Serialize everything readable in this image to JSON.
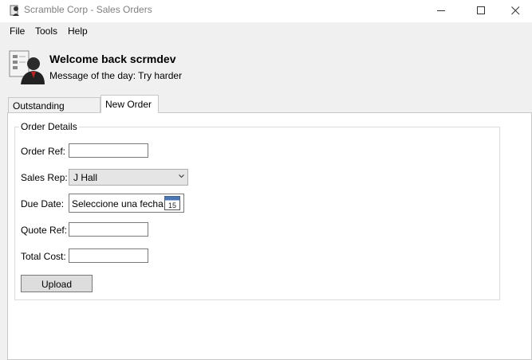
{
  "window": {
    "title": "Scramble Corp - Sales Orders"
  },
  "menu": {
    "file": "File",
    "tools": "Tools",
    "help": "Help"
  },
  "header": {
    "welcome": "Welcome back scrmdev",
    "motd": "Message of the day: Try harder"
  },
  "tabs": {
    "outstanding": "Outstanding Orders",
    "new_order": "New Order"
  },
  "form": {
    "group_title": "Order Details",
    "order_ref_label": "Order Ref:",
    "order_ref_value": "",
    "sales_rep_label": "Sales Rep:",
    "sales_rep_value": "J Hall",
    "due_date_label": "Due Date:",
    "due_date_value": "Seleccione una fecha",
    "calendar_day": "15",
    "quote_ref_label": "Quote Ref:",
    "quote_ref_value": "",
    "total_cost_label": "Total Cost:",
    "total_cost_value": "",
    "upload_label": "Upload"
  },
  "icons": {
    "app": "app-icon",
    "avatar": "user-avatar-icon",
    "calendar": "calendar-icon",
    "dropdown": "chevron-down-icon",
    "minimize": "minimize-icon",
    "maximize": "maximize-icon",
    "close": "close-icon"
  }
}
